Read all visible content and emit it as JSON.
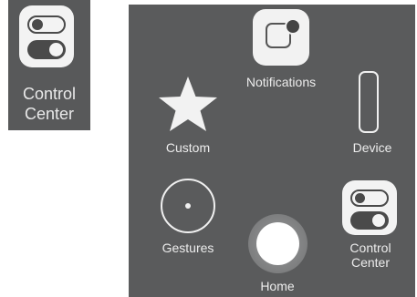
{
  "standalone_tile": {
    "label_line1": "Control",
    "label_line2": "Center",
    "icon": "toggle-switches-icon"
  },
  "menu": {
    "items": [
      {
        "label": "Notifications",
        "icon": "notifications-icon"
      },
      {
        "label": "Custom",
        "icon": "star-icon"
      },
      {
        "label": "Device",
        "icon": "device-phone-icon"
      },
      {
        "label": "Gestures",
        "icon": "gestures-icon"
      },
      {
        "label": "Home",
        "icon": "home-button-icon"
      },
      {
        "label_line1": "Control",
        "label_line2": "Center",
        "icon": "toggle-switches-icon"
      }
    ]
  },
  "colors": {
    "panel_background": "#5a5b5c",
    "label_text": "#ececec",
    "icon_tile": "#f3f3f3"
  }
}
